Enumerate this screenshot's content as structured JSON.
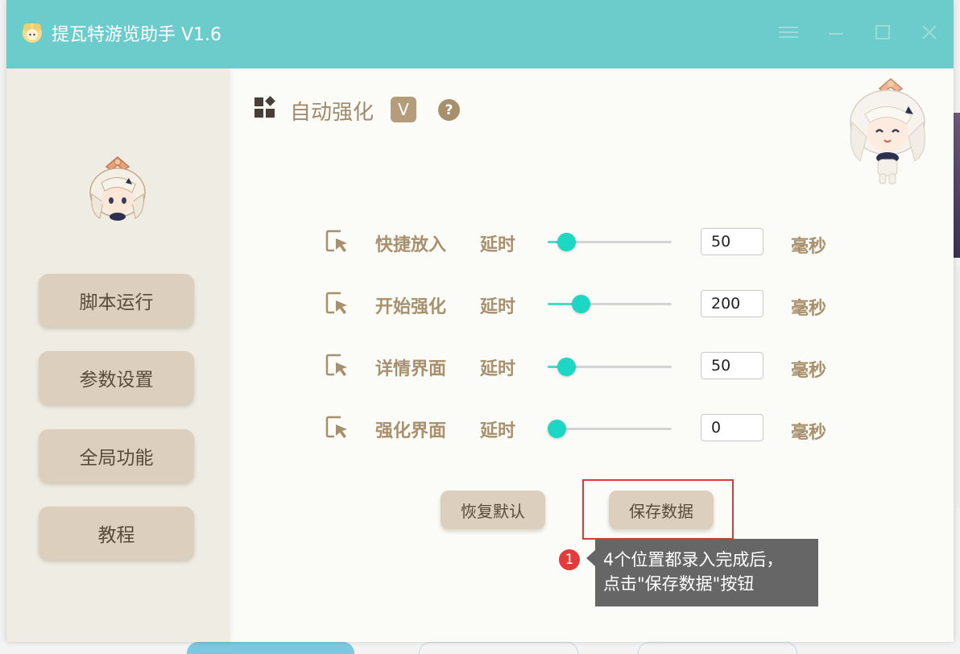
{
  "window": {
    "title": "提瓦特游览助手 V1.6",
    "controls": [
      "menu",
      "minimize",
      "maximize",
      "close"
    ]
  },
  "sidebar": {
    "items": [
      {
        "label": "脚本运行"
      },
      {
        "label": "参数设置"
      },
      {
        "label": "全局功能"
      },
      {
        "label": "教程"
      }
    ]
  },
  "header": {
    "title": "自动强化",
    "badge": "V",
    "help": "?"
  },
  "rows": [
    {
      "label": "快捷放入",
      "delay_label": "延时",
      "value": "50",
      "unit": "毫秒",
      "slider_fraction": 0.09
    },
    {
      "label": "开始强化",
      "delay_label": "延时",
      "value": "200",
      "unit": "毫秒",
      "slider_fraction": 0.23
    },
    {
      "label": "详情界面",
      "delay_label": "延时",
      "value": "50",
      "unit": "毫秒",
      "slider_fraction": 0.09
    },
    {
      "label": "强化界面",
      "delay_label": "延时",
      "value": "0",
      "unit": "毫秒",
      "slider_fraction": 0.0
    }
  ],
  "actions": {
    "reset_label": "恢复默认",
    "save_label": "保存数据"
  },
  "tutorial_tip": {
    "step": "1",
    "line1": "4个位置都录入完成后，",
    "line2": "点击\"保存数据\"按钮"
  },
  "colors": {
    "titlebar": "#6ccccc",
    "accent_text": "#a8906d",
    "button": "#dccfbd",
    "slider": "#1ed6c4",
    "highlight": "#d83b3b"
  }
}
